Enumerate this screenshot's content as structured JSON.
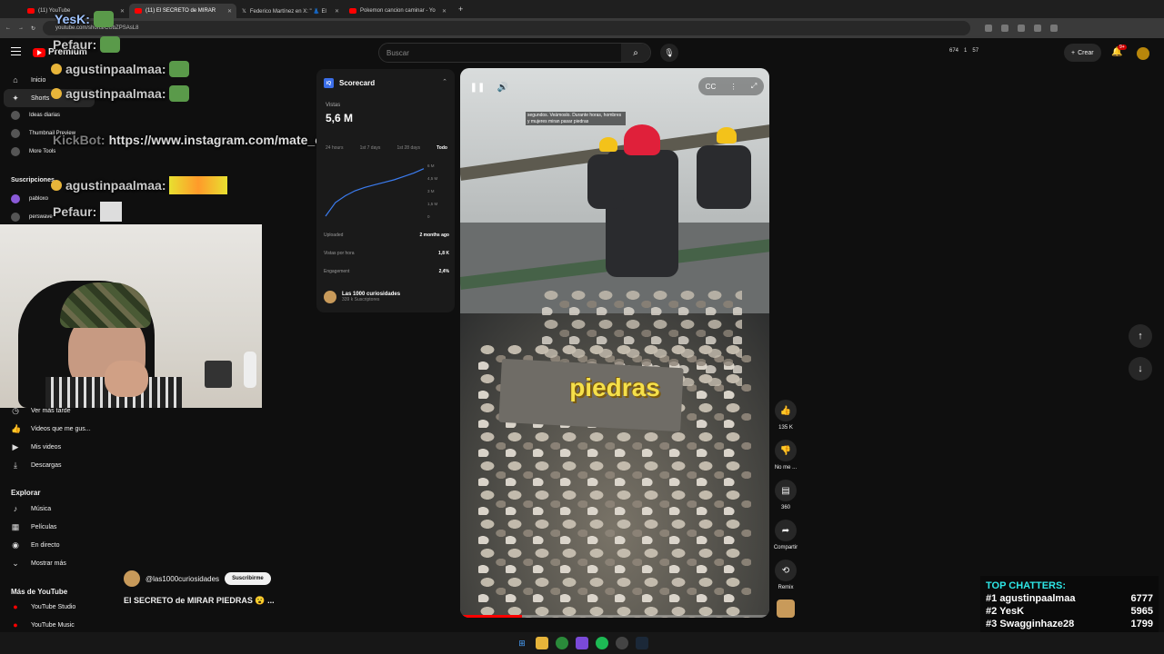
{
  "browser": {
    "tabs": [
      {
        "label": "(11) YouTube",
        "active": false
      },
      {
        "label": "(11) El SECRETO de MIRAR",
        "active": true
      },
      {
        "label": "Federico Martínez en X: \" 👗 El",
        "active": false
      },
      {
        "label": "Pokemon cancion caminar - Yo",
        "active": false
      }
    ],
    "url": "youtube.com/shorts/CUbZPSAsL8"
  },
  "header": {
    "brand": "Premium",
    "search_placeholder": "Buscar",
    "stats": [
      "674",
      "1",
      "57"
    ],
    "create_label": "Crear",
    "notification_count": "9+"
  },
  "sidebar": {
    "main": [
      {
        "icon": "home-icon",
        "glyph": "⌂",
        "label": "Inicio"
      },
      {
        "icon": "shorts-icon",
        "glyph": "✦",
        "label": "Shorts"
      }
    ],
    "extensions": [
      "Ideas diarias",
      "Thumbnail Preview",
      "More Tools"
    ],
    "subs_heading": "Suscripciones",
    "subs": [
      "pabloxo",
      "perswave"
    ],
    "you": [
      {
        "icon": "clock-icon",
        "glyph": "◷",
        "label": "Ver más tarde"
      },
      {
        "icon": "thumbs-up-icon",
        "glyph": "👍",
        "label": "Videos que me gus..."
      },
      {
        "icon": "play-square-icon",
        "glyph": "▶",
        "label": "Mis videos"
      },
      {
        "icon": "download-icon",
        "glyph": "⤓",
        "label": "Descargas"
      }
    ],
    "explore_heading": "Explorar",
    "explore": [
      {
        "icon": "music-icon",
        "glyph": "♪",
        "label": "Música"
      },
      {
        "icon": "film-icon",
        "glyph": "▦",
        "label": "Películas"
      },
      {
        "icon": "live-icon",
        "glyph": "((•))",
        "label": "En directo"
      },
      {
        "icon": "chevron-down-icon",
        "glyph": "⌄",
        "label": "Mostrar más"
      }
    ],
    "more_heading": "Más de YouTube",
    "more": [
      "YouTube Studio",
      "YouTube Music"
    ]
  },
  "chat_overlay": [
    {
      "user": "YesK:",
      "text": ""
    },
    {
      "user": "Pefaur:",
      "text": ""
    },
    {
      "user": "agustinpaalmaa:",
      "text": ""
    },
    {
      "user": "agustinpaalmaa:",
      "text": ""
    },
    {
      "user": "KickBot:",
      "text": "https://www.instagram.com/mate_capp/"
    },
    {
      "user": "agustinpaalmaa:",
      "text": ""
    },
    {
      "user": "Pefaur:",
      "text": ""
    }
  ],
  "scorecard": {
    "title": "Scorecard",
    "views_label": "Vistas",
    "views_value": "5,6 M",
    "tabs": [
      "24 hours",
      "1st 7 days",
      "1st 28 days",
      "Todo"
    ],
    "active_tab": "Todo",
    "y_ticks": [
      "6 M",
      "4,5 M",
      "3 M",
      "1,5 M",
      "0"
    ],
    "chart_data": {
      "type": "line",
      "x": [
        0,
        1,
        2,
        3,
        4,
        5,
        6,
        7,
        8,
        9,
        10
      ],
      "y": [
        0,
        1.6,
        2.4,
        3.0,
        3.4,
        3.7,
        4.0,
        4.3,
        4.7,
        5.1,
        5.6
      ],
      "ylim": [
        0,
        6
      ]
    },
    "rows": [
      {
        "label": "Uploaded",
        "value": "2 months ago"
      },
      {
        "label": "Vistas por hora",
        "value": "1,8 K"
      },
      {
        "label": "Engagement",
        "value": "2,4%"
      }
    ],
    "channel_name": "Las 1000 curiosidades",
    "channel_subs": "339 k Suscriptores"
  },
  "video": {
    "subtitle": "segundos. Veámoslo. Durante horas, hombres y mujeres miran pasar piedras",
    "caption": "piedras",
    "progress": 0.2
  },
  "actions": {
    "like_count": "135 K",
    "dislike_label": "No me ...",
    "comments_count": "360",
    "share_label": "Compartir",
    "remix_label": "Remix"
  },
  "channel": {
    "handle": "@las1000curiosidades",
    "subscribe_label": "Suscribirme",
    "video_title": "El SECRETO de MIRAR PIEDRAS 😮 ..."
  },
  "top_chatters": {
    "title": "TOP CHATTERS:",
    "rows": [
      {
        "rank": "#1",
        "name": "agustinpaalmaa",
        "count": "6777"
      },
      {
        "rank": "#2",
        "name": "YesK",
        "count": "5965"
      },
      {
        "rank": "#3",
        "name": "Swagginhaze28",
        "count": "1799"
      }
    ]
  },
  "colors": {
    "accent": "#ff0000",
    "chatters_title": "#2ee6e6",
    "caption": "#f5e04a"
  }
}
